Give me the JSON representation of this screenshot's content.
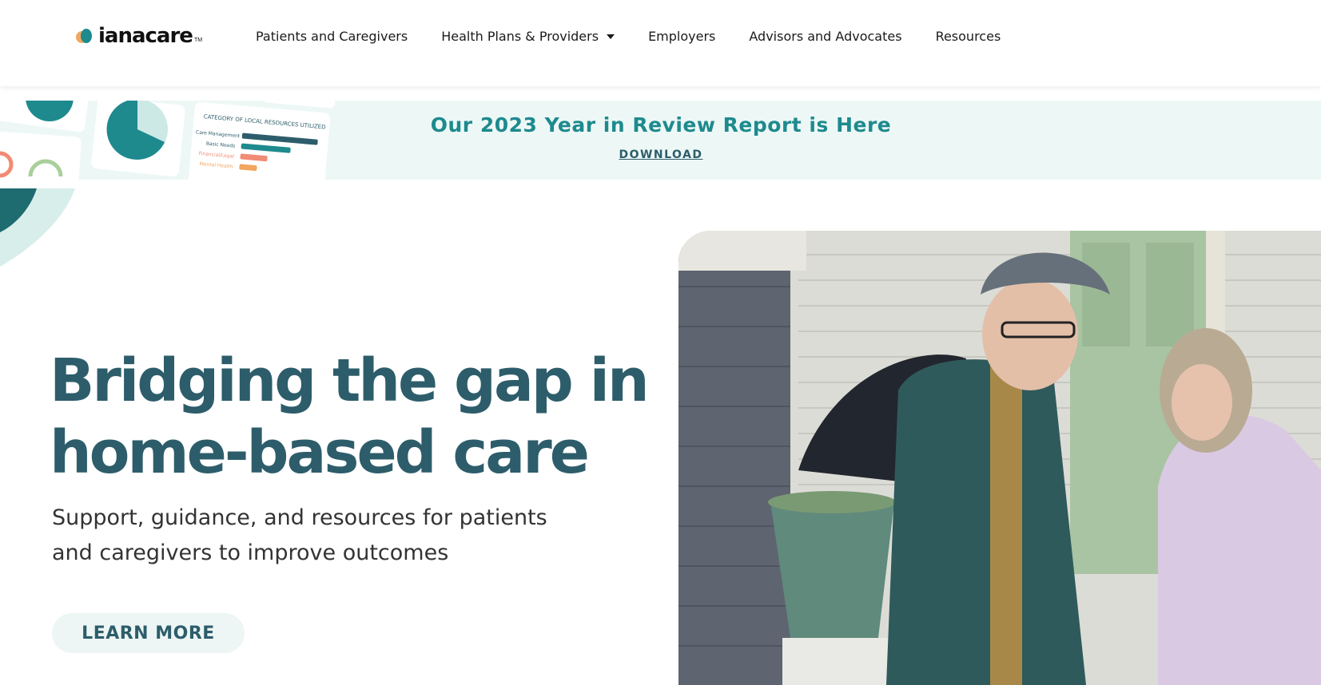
{
  "brand": {
    "name": "ianacare",
    "tm": "TM"
  },
  "nav": {
    "items": [
      {
        "label": "Patients and Caregivers",
        "has_dropdown": false
      },
      {
        "label": "Health Plans & Providers",
        "has_dropdown": true
      },
      {
        "label": "Employers",
        "has_dropdown": false
      },
      {
        "label": "Advisors and Advocates",
        "has_dropdown": false
      },
      {
        "label": "Resources",
        "has_dropdown": false
      }
    ]
  },
  "banner": {
    "title": "Our 2023 Year in Review Report is Here",
    "link": "DOWNLOAD",
    "art_heading": "CATEGORY OF LOCAL RESOURCES UTILIZED",
    "art_rows": [
      "Care Management",
      "Basic Needs",
      "Financial/Legal",
      "Mental Health"
    ]
  },
  "hero": {
    "title_line1": "Bridging the gap in",
    "title_line2": "home-based care",
    "subtitle_line1": "Support, guidance, and resources for patients",
    "subtitle_line2": "and caregivers to improve outcomes",
    "cta_label": "LEARN MORE"
  },
  "colors": {
    "brand_teal": "#1e8a8e",
    "heading": "#2d5d6b",
    "banner_bg": "#edf8f6",
    "logo_orange": "#f2a65e"
  }
}
